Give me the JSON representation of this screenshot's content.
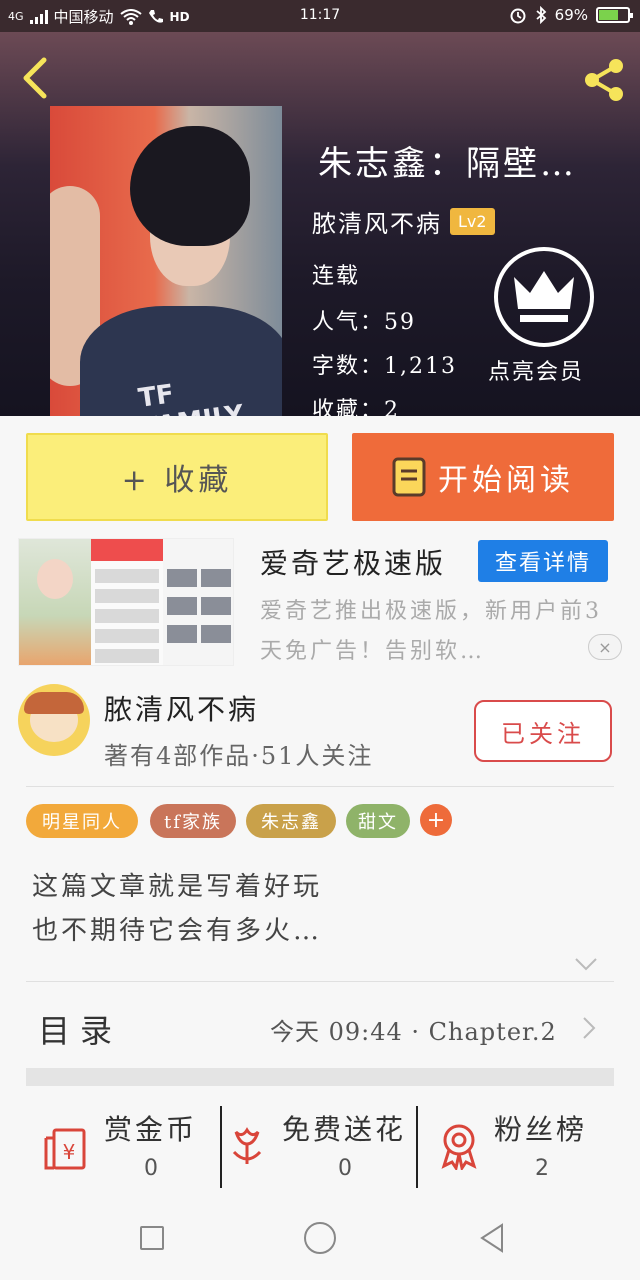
{
  "status_bar": {
    "network": "4G",
    "carrier": "中国移动",
    "volte": "HD",
    "time": "11:17",
    "battery": "69%",
    "battery_level": 0.69
  },
  "header": {
    "book_title": "朱志鑫：隔壁…",
    "author": "脓清风不病",
    "level": "Lv2",
    "status": "连载",
    "popularity": "人气：59",
    "word_count": "字数：1,213",
    "favorites": "收藏：2",
    "vip_label": "点亮会员",
    "cover_text": "TF FAMILY"
  },
  "actions": {
    "collect_label": "+ 收藏",
    "read_label": "开始阅读"
  },
  "ad": {
    "title": "爱奇艺极速版",
    "detail_button": "查看详情",
    "description": "爱奇艺推出极速版，新用户前3天免广告！告别软…"
  },
  "author_card": {
    "name": "脓清风不病",
    "stats": "著有4部作品·51人关注",
    "follow_button": "已关注"
  },
  "tags": [
    {
      "label": "明星同人",
      "color": "#f2a93b"
    },
    {
      "label": "tf家族",
      "color": "#c9755a"
    },
    {
      "label": "朱志鑫",
      "color": "#c9a14a"
    },
    {
      "label": "甜文",
      "color": "#8fb369"
    }
  ],
  "tag_add": "+",
  "description": {
    "line1": "这篇文章就是写着好玩",
    "line2": "也不期待它会有多火…"
  },
  "toc": {
    "label": "目录",
    "latest": "今天 09:44 · Chapter.2"
  },
  "bottom_stats": [
    {
      "label": "赏金币",
      "value": "0"
    },
    {
      "label": "免费送花",
      "value": "0"
    },
    {
      "label": "粉丝榜",
      "value": "2"
    }
  ],
  "colors": {
    "accent_orange": "#ef6b3a",
    "collect_yellow": "#fbee7a",
    "follow_red": "#d94b4b",
    "detail_blue": "#1f7fe6",
    "icon_red": "#d9453a",
    "back_yellow": "#f6e45a"
  }
}
